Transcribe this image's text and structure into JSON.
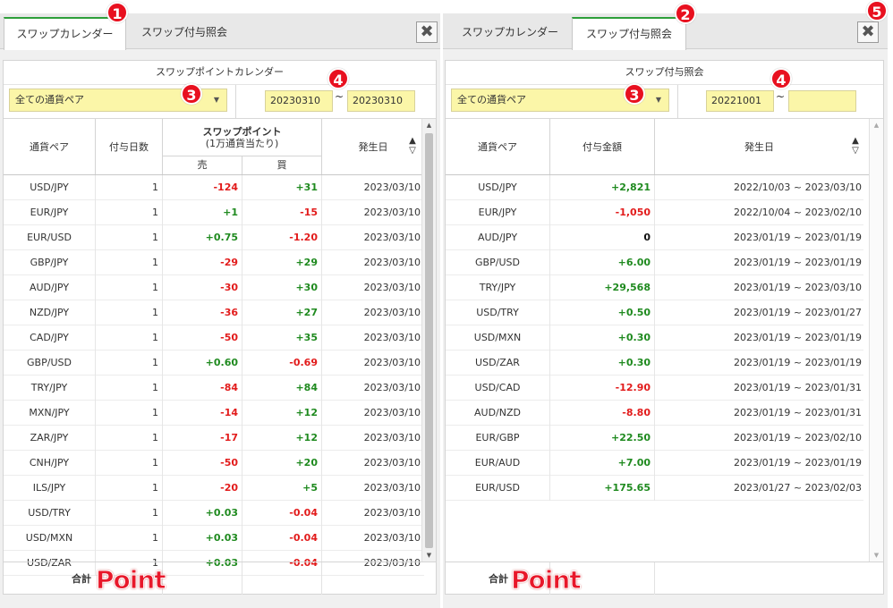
{
  "left": {
    "tabs": [
      {
        "label": "スワップカレンダー",
        "active": true
      },
      {
        "label": "スワップ付与照会",
        "active": false
      }
    ],
    "close_label": "✖",
    "title": "スワップポイントカレンダー",
    "pair_select": "全ての通貨ペア",
    "date_from": "20230310",
    "date_to": "20230310",
    "date_sep": "~",
    "headers": {
      "pair": "通貨ペア",
      "days": "付与日数",
      "swap_line1": "スワップポイント",
      "swap_line2": "(1万通貨当たり)",
      "sell": "売",
      "buy": "買",
      "date": "発生日",
      "sort": "▲\n▽"
    },
    "rows": [
      {
        "pair": "USD/JPY",
        "days": "1",
        "sell": "-124",
        "buy": "+31",
        "date": "2023/03/10"
      },
      {
        "pair": "EUR/JPY",
        "days": "1",
        "sell": "+1",
        "buy": "-15",
        "date": "2023/03/10"
      },
      {
        "pair": "EUR/USD",
        "days": "1",
        "sell": "+0.75",
        "buy": "-1.20",
        "date": "2023/03/10"
      },
      {
        "pair": "GBP/JPY",
        "days": "1",
        "sell": "-29",
        "buy": "+29",
        "date": "2023/03/10"
      },
      {
        "pair": "AUD/JPY",
        "days": "1",
        "sell": "-30",
        "buy": "+30",
        "date": "2023/03/10"
      },
      {
        "pair": "NZD/JPY",
        "days": "1",
        "sell": "-36",
        "buy": "+27",
        "date": "2023/03/10"
      },
      {
        "pair": "CAD/JPY",
        "days": "1",
        "sell": "-50",
        "buy": "+35",
        "date": "2023/03/10"
      },
      {
        "pair": "GBP/USD",
        "days": "1",
        "sell": "+0.60",
        "buy": "-0.69",
        "date": "2023/03/10"
      },
      {
        "pair": "TRY/JPY",
        "days": "1",
        "sell": "-84",
        "buy": "+84",
        "date": "2023/03/10"
      },
      {
        "pair": "MXN/JPY",
        "days": "1",
        "sell": "-14",
        "buy": "+12",
        "date": "2023/03/10"
      },
      {
        "pair": "ZAR/JPY",
        "days": "1",
        "sell": "-17",
        "buy": "+12",
        "date": "2023/03/10"
      },
      {
        "pair": "CNH/JPY",
        "days": "1",
        "sell": "-50",
        "buy": "+20",
        "date": "2023/03/10"
      },
      {
        "pair": "ILS/JPY",
        "days": "1",
        "sell": "-20",
        "buy": "+5",
        "date": "2023/03/10"
      },
      {
        "pair": "USD/TRY",
        "days": "1",
        "sell": "+0.03",
        "buy": "-0.04",
        "date": "2023/03/10"
      },
      {
        "pair": "USD/MXN",
        "days": "1",
        "sell": "+0.03",
        "buy": "-0.04",
        "date": "2023/03/10"
      },
      {
        "pair": "USD/ZAR",
        "days": "1",
        "sell": "+0.03",
        "buy": "-0.04",
        "date": "2023/03/10"
      }
    ],
    "total_label": "合計",
    "point_label": "Point"
  },
  "right": {
    "tabs": [
      {
        "label": "スワップカレンダー",
        "active": false
      },
      {
        "label": "スワップ付与照会",
        "active": true
      }
    ],
    "close_label": "✖",
    "title": "スワップ付与照会",
    "pair_select": "全ての通貨ペア",
    "date_from": "20221001",
    "date_to": "",
    "date_sep": "~",
    "headers": {
      "pair": "通貨ペア",
      "amount": "付与金額",
      "date": "発生日",
      "sort": "▲\n▽"
    },
    "rows": [
      {
        "pair": "USD/JPY",
        "amount": "+2,821",
        "date": "2022/10/03 ~ 2023/03/10"
      },
      {
        "pair": "EUR/JPY",
        "amount": "-1,050",
        "date": "2022/10/04 ~ 2023/02/10"
      },
      {
        "pair": "AUD/JPY",
        "amount": "0",
        "date": "2023/01/19 ~ 2023/01/19"
      },
      {
        "pair": "GBP/USD",
        "amount": "+6.00",
        "date": "2023/01/19 ~ 2023/01/19"
      },
      {
        "pair": "TRY/JPY",
        "amount": "+29,568",
        "date": "2023/01/19 ~ 2023/03/10"
      },
      {
        "pair": "USD/TRY",
        "amount": "+0.50",
        "date": "2023/01/19 ~ 2023/01/27"
      },
      {
        "pair": "USD/MXN",
        "amount": "+0.30",
        "date": "2023/01/19 ~ 2023/01/19"
      },
      {
        "pair": "USD/ZAR",
        "amount": "+0.30",
        "date": "2023/01/19 ~ 2023/01/19"
      },
      {
        "pair": "USD/CAD",
        "amount": "-12.90",
        "date": "2023/01/19 ~ 2023/01/31"
      },
      {
        "pair": "AUD/NZD",
        "amount": "-8.80",
        "date": "2023/01/19 ~ 2023/01/31"
      },
      {
        "pair": "EUR/GBP",
        "amount": "+22.50",
        "date": "2023/01/19 ~ 2023/02/10"
      },
      {
        "pair": "EUR/AUD",
        "amount": "+7.00",
        "date": "2023/01/19 ~ 2023/01/19"
      },
      {
        "pair": "EUR/USD",
        "amount": "+175.65",
        "date": "2023/01/27 ~ 2023/02/03"
      }
    ],
    "total_label": "合計",
    "point_label": "Point"
  },
  "badges": {
    "b1": "1",
    "b2": "2",
    "b3": "3",
    "b4": "4",
    "b5": "5"
  },
  "colors": {
    "positive": "#1f8a1f",
    "negative": "#e21b1b",
    "input_bg": "#fbf6a8",
    "tab_accent": "#2e9f3a",
    "badge": "#e8101f",
    "point": "#e8182a"
  }
}
